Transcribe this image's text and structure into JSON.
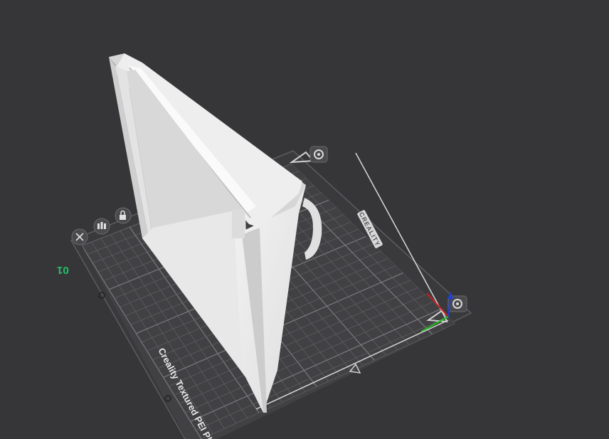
{
  "plate": {
    "number": "01",
    "bed_name": "Creality Textured PEI Plate",
    "brand": "CREALITY"
  },
  "tools": {
    "close_icon": "close-icon",
    "arrange_icon": "arrange-icon",
    "lock_icon": "lock-icon",
    "plate_settings_icon": "plate-settings-icon",
    "slice_plate_icon": "slice-plate-icon"
  },
  "colors": {
    "background": "#363638",
    "bed": "#3d3d40",
    "grid": "#6a6a6e",
    "model": "#e6e6e6",
    "plate_number": "#1fc26a",
    "axis_x": "#d02020",
    "axis_y": "#20c020",
    "axis_z": "#2040d0"
  }
}
